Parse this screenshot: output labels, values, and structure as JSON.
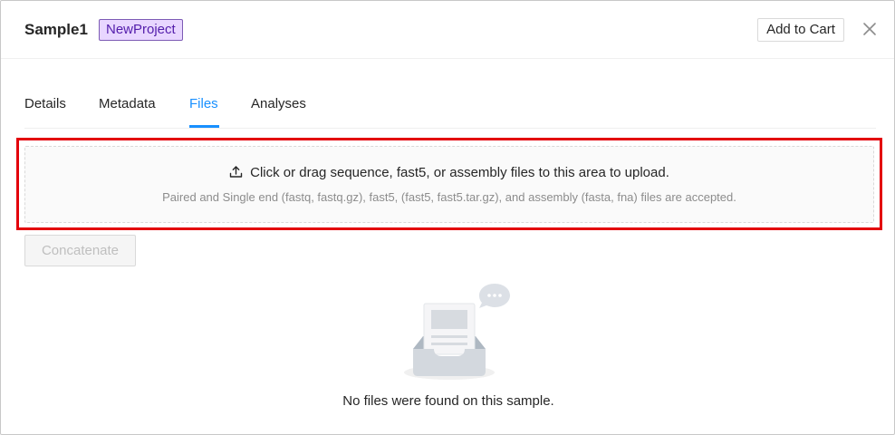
{
  "header": {
    "title": "Sample1",
    "project_tag": "NewProject",
    "add_to_cart_label": "Add to Cart"
  },
  "tabs": [
    {
      "label": "Details",
      "active": false
    },
    {
      "label": "Metadata",
      "active": false
    },
    {
      "label": "Files",
      "active": true
    },
    {
      "label": "Analyses",
      "active": false
    }
  ],
  "upload": {
    "main_text": "Click or drag sequence, fast5, or assembly files to this area to upload.",
    "hint_text": "Paired and Single end (fastq, fastq.gz), fast5, (fast5, fast5.tar.gz), and assembly (fasta, fna) files are accepted.",
    "icon": "upload-icon"
  },
  "actions": {
    "concatenate_label": "Concatenate"
  },
  "empty": {
    "message": "No files were found on this sample.",
    "icon": "empty-inbox-icon"
  },
  "colors": {
    "accent": "#1890ff",
    "tag_bg": "#e8d6ff",
    "tag_text": "#531dab",
    "highlight": "#e3000b"
  }
}
